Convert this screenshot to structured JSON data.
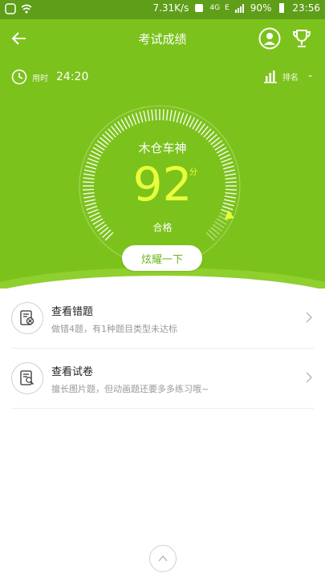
{
  "status_bar": {
    "speed": "7.31K/s",
    "network": "4G",
    "extra": "E",
    "battery": "90%",
    "time": "23:56"
  },
  "header": {
    "title": "考试成绩",
    "back_icon": "arrow-left-icon",
    "profile_icon": "profile-icon",
    "trophy_icon": "trophy-icon"
  },
  "stats": {
    "time_label": "用时",
    "time_value": "24:20",
    "rank_label": "排名",
    "rank_value": "-"
  },
  "score": {
    "user_name": "木仓车神",
    "value": "92",
    "unit": "分",
    "result": "合格",
    "level": 0.92
  },
  "share_label": "炫耀一下",
  "list": [
    {
      "title": "查看错题",
      "desc": "做错4题，有1种题目类型未达标"
    },
    {
      "title": "查看试卷",
      "desc": "擅长图片题，但动画题还要多多练习哦~"
    }
  ],
  "colors": {
    "primary": "#7cc21c",
    "status": "#5f9e19",
    "score": "#e8ff3b",
    "white": "#ffffff"
  }
}
